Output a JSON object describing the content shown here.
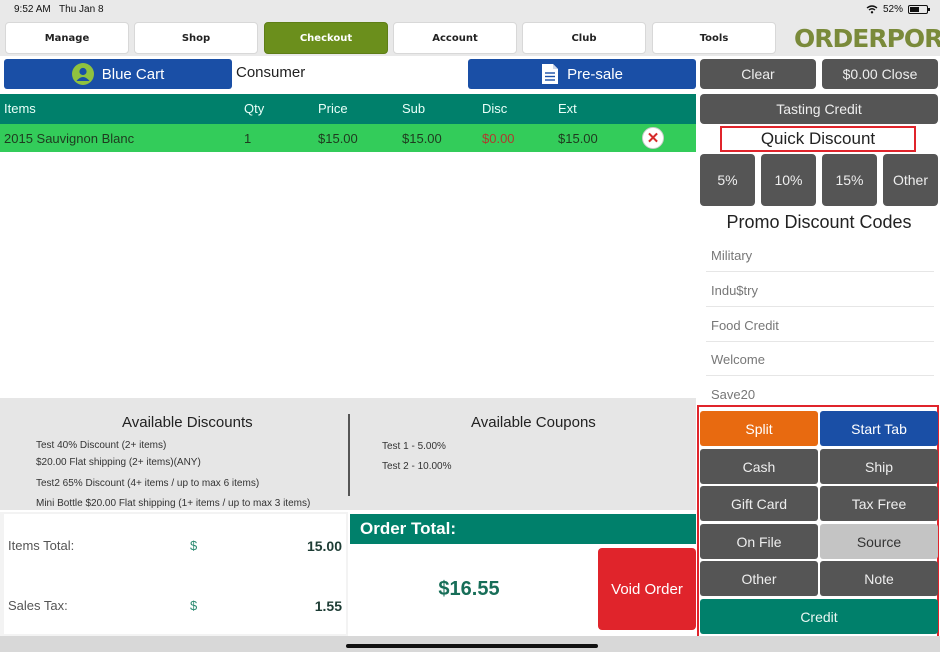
{
  "status_bar": {
    "time": "9:52 AM",
    "date": "Thu Jan 8",
    "battery": "52%"
  },
  "nav": {
    "items": [
      "Manage",
      "Shop",
      "Checkout",
      "Account",
      "Club",
      "Tools"
    ],
    "active": "Checkout",
    "logo_text": "ORDERPORT"
  },
  "cart": {
    "cart_label": "Blue Cart",
    "customer_type": "Consumer",
    "presale_label": "Pre-sale"
  },
  "top_actions": {
    "clear": "Clear",
    "close": "$0.00 Close",
    "tasting_credit": "Tasting Credit"
  },
  "grid": {
    "headers": [
      "Items",
      "Qty",
      "Price",
      "Sub",
      "Disc",
      "Ext"
    ],
    "rows": [
      {
        "item": "2015 Sauvignon Blanc",
        "qty": "1",
        "price": "$15.00",
        "sub": "$15.00",
        "disc": "$0.00",
        "ext": "$15.00"
      }
    ]
  },
  "discounts": {
    "title": "Available Discounts",
    "items": [
      "Test 40% Discount (2+ items)",
      "$20.00 Flat shipping (2+ items)(ANY)",
      "Test2 65% Discount (4+ items / up to max 6 items)",
      "Mini Bottle $20.00 Flat shipping (1+ items / up to max 3 items)"
    ]
  },
  "coupons": {
    "title": "Available Coupons",
    "items": [
      "Test 1 - 5.00%",
      "Test 2 - 10.00%"
    ]
  },
  "totals": {
    "items_total_label": "Items Total:",
    "items_total_currency": "$",
    "items_total": "15.00",
    "sales_tax_label": "Sales Tax:",
    "sales_tax_currency": "$",
    "sales_tax": "1.55"
  },
  "order_total": {
    "label": "Order Total:",
    "amount": "$16.55",
    "void_label": "Void Order"
  },
  "quick_discount": {
    "title": "Quick Discount",
    "options": [
      "5%",
      "10%",
      "15%",
      "Other"
    ]
  },
  "promo": {
    "title": "Promo Discount Codes",
    "codes": [
      "Military",
      "Indu$try",
      "Food Credit",
      "Welcome",
      "Save20"
    ]
  },
  "payment": {
    "split": "Split",
    "start_tab": "Start Tab",
    "cash": "Cash",
    "ship": "Ship",
    "gift_card": "Gift Card",
    "tax_free": "Tax Free",
    "on_file": "On File",
    "source": "Source",
    "other": "Other",
    "note": "Note",
    "credit": "Credit"
  },
  "colors": {
    "nav_active": "#6b8f1c",
    "teal": "#00806b",
    "selected_row": "#33cc5a",
    "blue": "#1a4fa6",
    "red": "#e0242b",
    "orange": "#e86a10",
    "dark_button": "#555555",
    "logo": "#7a8a3a"
  },
  "icons": [
    "wifi-icon",
    "battery-icon",
    "logo-icon",
    "user-icon",
    "document-icon",
    "remove-icon"
  ]
}
